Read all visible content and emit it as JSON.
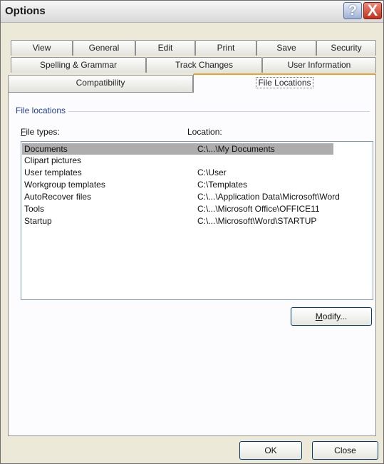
{
  "window": {
    "title": "Options",
    "help_glyph": "?",
    "close_glyph": "X"
  },
  "tabs": {
    "row1": [
      "View",
      "General",
      "Edit",
      "Print",
      "Save",
      "Security"
    ],
    "row2": [
      "Spelling & Grammar",
      "Track Changes",
      "User Information"
    ],
    "row3": [
      "Compatibility",
      "File Locations"
    ],
    "active": "File Locations"
  },
  "file_locations": {
    "group_label": "File locations",
    "col_file_types_first": "F",
    "col_file_types_rest": "ile types:",
    "col_location": "Location:",
    "rows": [
      {
        "type": "Documents",
        "location": "C:\\...\\My Documents",
        "selected": true
      },
      {
        "type": "Clipart pictures",
        "location": ""
      },
      {
        "type": "User templates",
        "location": "C:\\User"
      },
      {
        "type": "Workgroup templates",
        "location": "C:\\Templates"
      },
      {
        "type": "AutoRecover files",
        "location": "C:\\...\\Application Data\\Microsoft\\Word"
      },
      {
        "type": "Tools",
        "location": "C:\\...\\Microsoft Office\\OFFICE11"
      },
      {
        "type": "Startup",
        "location": "C:\\...\\Microsoft\\Word\\STARTUP"
      }
    ],
    "modify_first": "M",
    "modify_rest": "odify..."
  },
  "footer": {
    "ok_label": "OK",
    "close_label": "Close"
  }
}
